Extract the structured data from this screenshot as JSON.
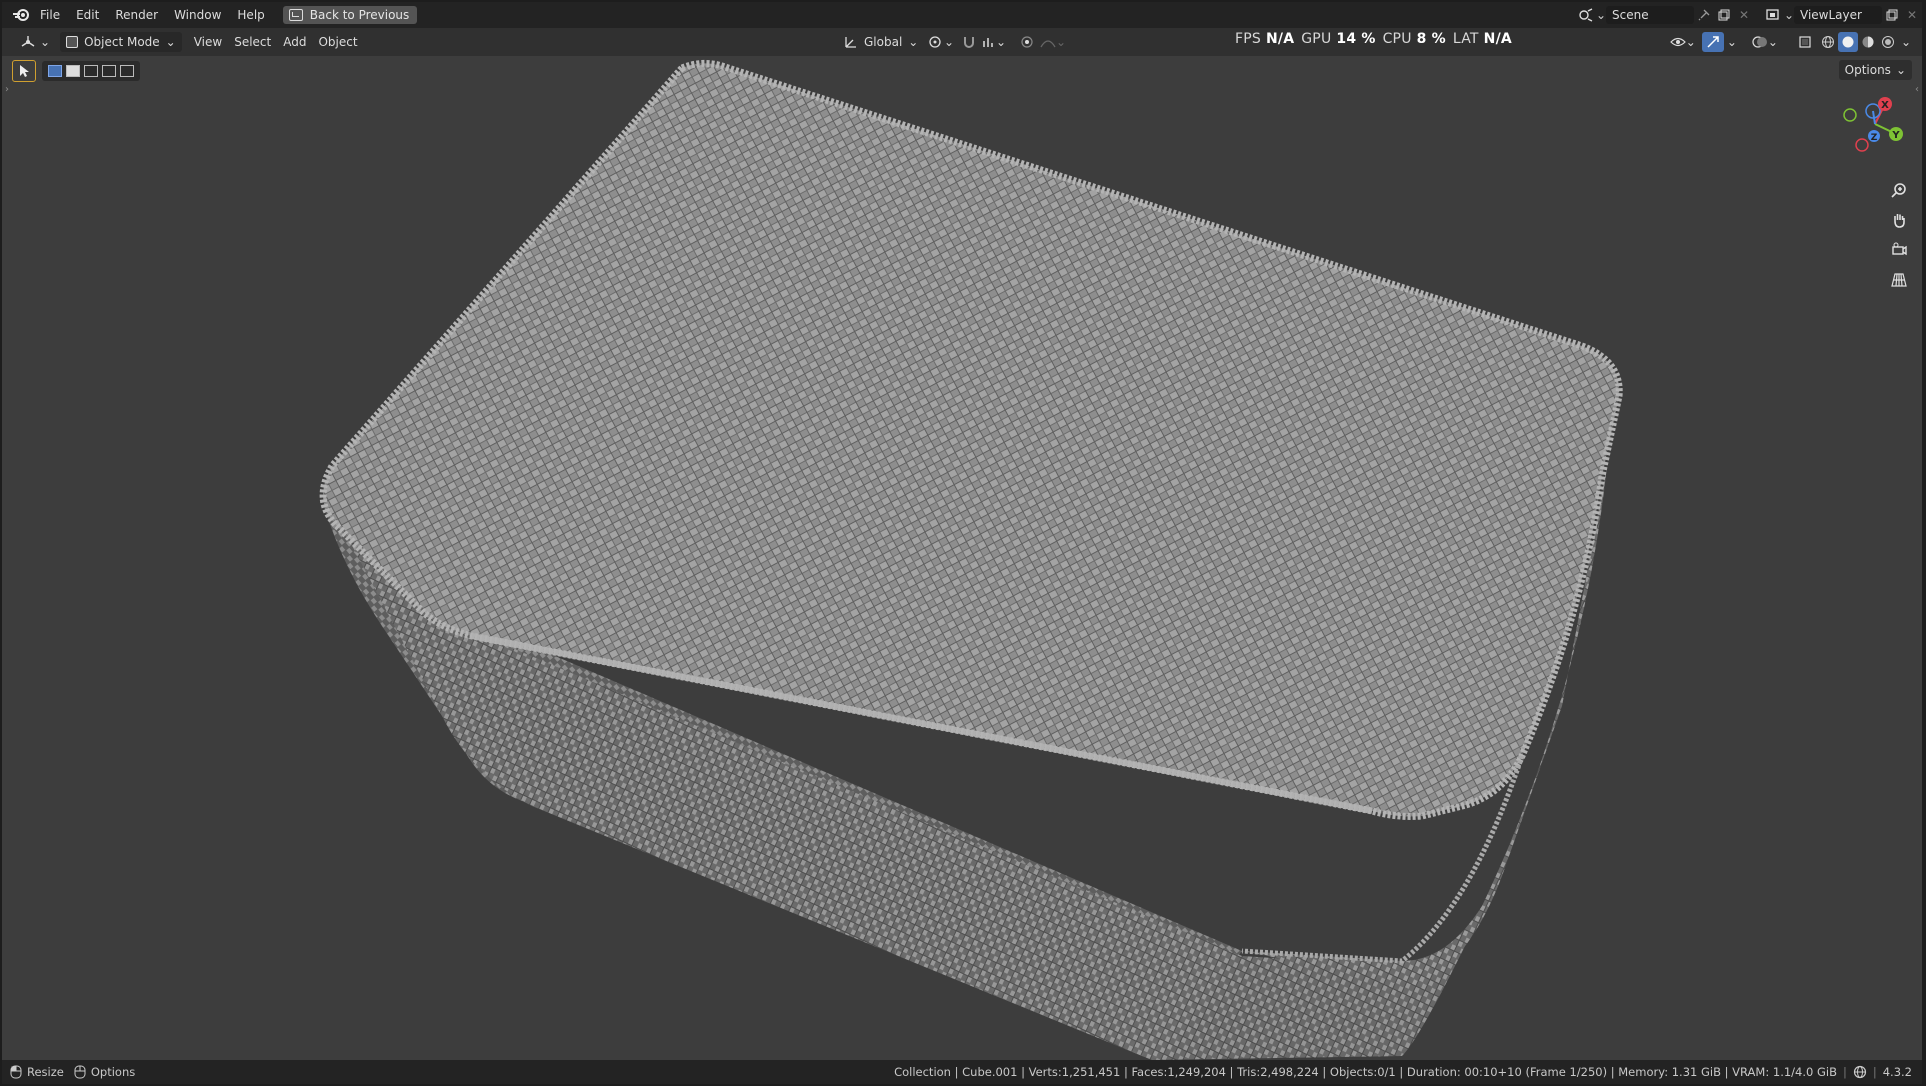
{
  "menubar": {
    "items": [
      "File",
      "Edit",
      "Render",
      "Window",
      "Help"
    ],
    "back_button": "Back to Previous"
  },
  "scene": {
    "label": "Scene"
  },
  "viewlayer": {
    "label": "ViewLayer"
  },
  "header": {
    "mode": "Object Mode",
    "menus": [
      "View",
      "Select",
      "Add",
      "Object"
    ],
    "orientation": "Global",
    "options": "Options"
  },
  "performance": {
    "fps_label": "FPS",
    "fps_value": "N/A",
    "gpu_label": "GPU",
    "gpu_value": "14 %",
    "cpu_label": "CPU",
    "cpu_value": "8 %",
    "lat_label": "LAT",
    "lat_value": "N/A"
  },
  "gizmo": {
    "x": "X",
    "y": "Y",
    "z": "Z"
  },
  "statusbar": {
    "resize": "Resize",
    "options": "Options",
    "info": "Collection | Cube.001 | Verts:1,251,451 | Faces:1,249,204 | Tris:2,498,224 | Objects:0/1 | Duration: 00:10+10 (Frame 1/250) | Memory: 1.31 GiB | VRAM: 1.1/4.0 GiB",
    "version": "4.3.2"
  },
  "colors": {
    "accent": "#4772b3",
    "axis_x": "#e0404e",
    "axis_y": "#7ec234",
    "axis_z": "#4a8ae8",
    "mesh": "#8f8f8f"
  }
}
